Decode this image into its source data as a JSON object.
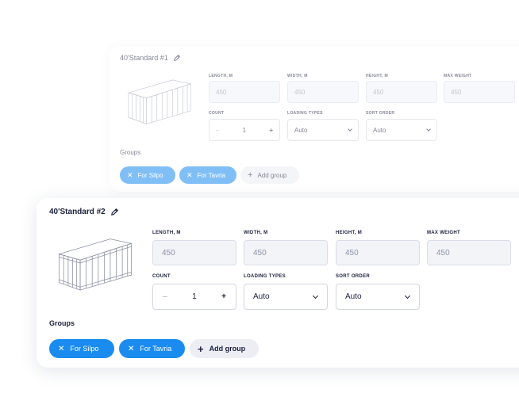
{
  "cards": [
    {
      "title": "40'Standard #1",
      "fields": [
        {
          "label": "LENGTH, M",
          "value": "450"
        },
        {
          "label": "WIDTH, M",
          "value": "450"
        },
        {
          "label": "HEIGHT, M",
          "value": "450"
        },
        {
          "label": "MAX WEIGHT",
          "value": "450"
        }
      ],
      "count": {
        "label": "COUNT",
        "value": "1",
        "minus": "–",
        "plus": "+"
      },
      "loading_types": {
        "label": "LOADING TYPES",
        "value": "Auto"
      },
      "sort_order": {
        "label": "SORT ORDER",
        "value": "Auto"
      },
      "groups_label": "Groups",
      "groups": [
        "For Silpo",
        "For Tavria"
      ],
      "add_group": "Add group"
    },
    {
      "title": "40'Standard #2",
      "fields": [
        {
          "label": "LENGTH, M",
          "value": "450"
        },
        {
          "label": "WIDTH, M",
          "value": "450"
        },
        {
          "label": "HEIGHT, M",
          "value": "450"
        },
        {
          "label": "MAX WEIGHT",
          "value": "450"
        }
      ],
      "count": {
        "label": "COUNT",
        "value": "1",
        "minus": "–",
        "plus": "+"
      },
      "loading_types": {
        "label": "LOADING TYPES",
        "value": "Auto"
      },
      "sort_order": {
        "label": "SORT ORDER",
        "value": "Auto"
      },
      "groups_label": "Groups",
      "groups": [
        "For Silpo",
        "For Tavria"
      ],
      "add_group": "Add group"
    }
  ],
  "colors": {
    "accent": "#1a8cf0",
    "text": "#1b1f3b",
    "field_bg": "#f2f4f8"
  }
}
